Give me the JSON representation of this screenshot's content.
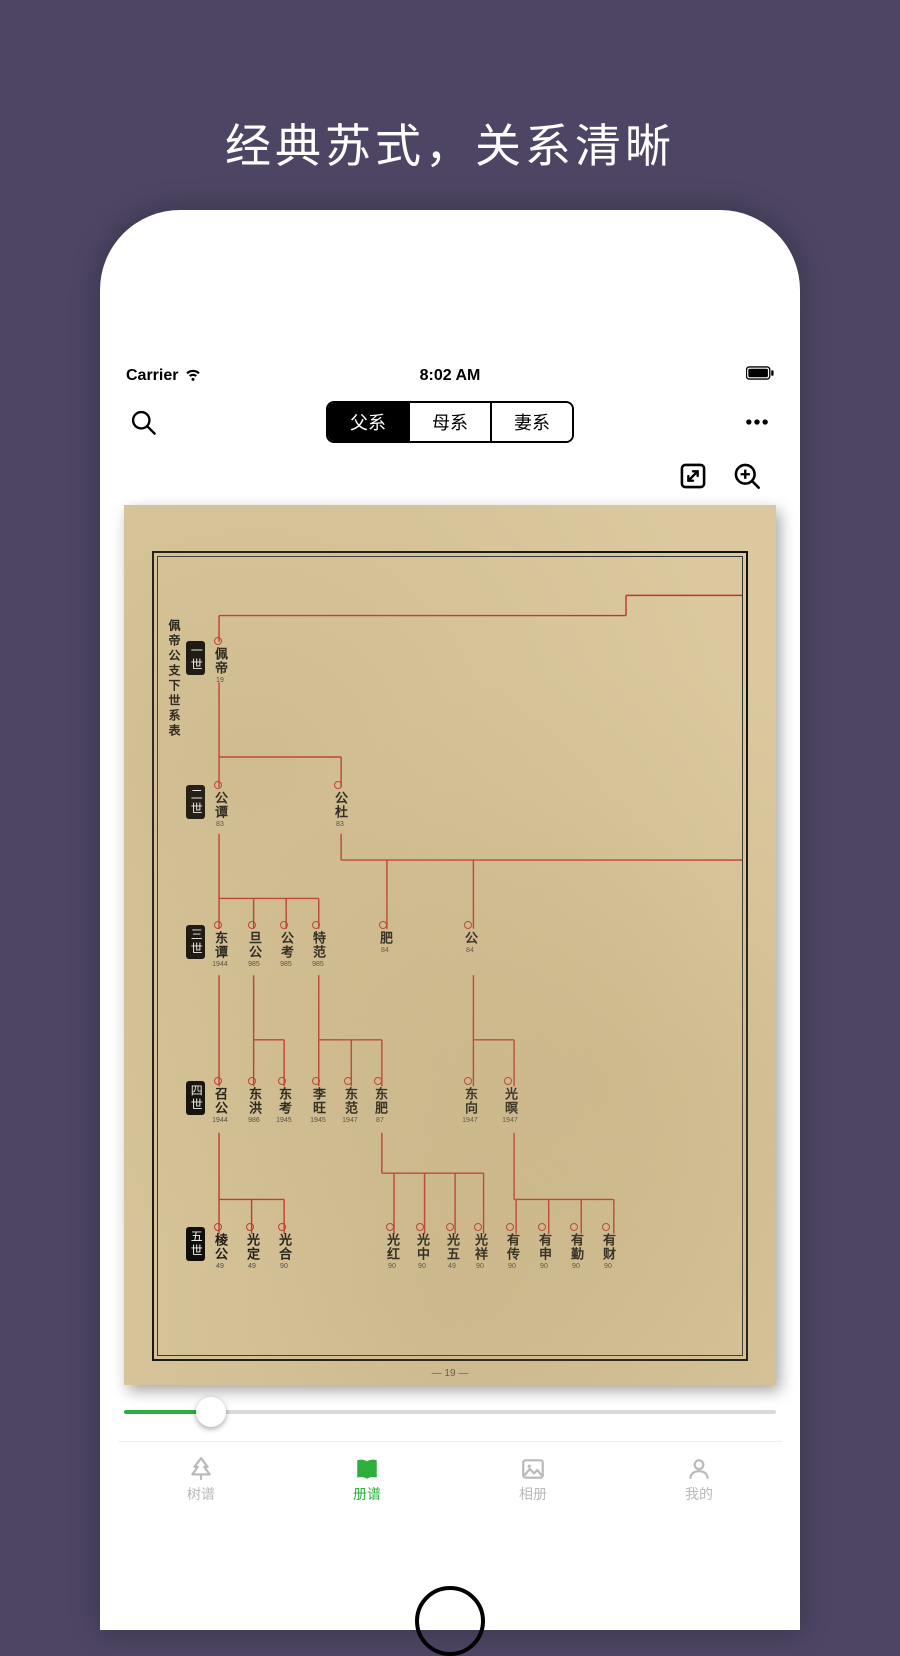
{
  "hero": "经典苏式，关系清晰",
  "status": {
    "carrier": "Carrier",
    "time": "8:02 AM"
  },
  "seg": {
    "active": "父系",
    "opts": [
      "父系",
      "母系",
      "妻系"
    ]
  },
  "pageNum": "— 19 —",
  "chartTitle": "佩帝公支下世系表",
  "gens": [
    "一世",
    "二世",
    "三世",
    "四世",
    "五世"
  ],
  "g1": [
    {
      "n": "佩帝",
      "s": "19"
    }
  ],
  "g2": [
    {
      "n": "公谭",
      "s": "83"
    },
    {
      "n": "公杜",
      "s": "83"
    }
  ],
  "g3": [
    {
      "n": "东谭",
      "s": "1944"
    },
    {
      "n": "旦公",
      "s": "985"
    },
    {
      "n": "公考",
      "s": "985"
    },
    {
      "n": "特范",
      "s": "985"
    },
    {
      "n": "肥",
      "s": "84"
    },
    {
      "n": "公",
      "s": "84"
    }
  ],
  "g4": [
    {
      "n": "召公",
      "s": "1944"
    },
    {
      "n": "东洪",
      "s": "986"
    },
    {
      "n": "东考",
      "s": "1945"
    },
    {
      "n": "李旺",
      "s": "1945"
    },
    {
      "n": "东范",
      "s": "1947"
    },
    {
      "n": "东肥",
      "s": "87"
    },
    {
      "n": "东向",
      "s": "1947"
    },
    {
      "n": "光暝",
      "s": "1947"
    }
  ],
  "g5": [
    {
      "n": "棱公",
      "s": "49"
    },
    {
      "n": "光定",
      "s": "49"
    },
    {
      "n": "光合",
      "s": "90"
    },
    {
      "n": "光红",
      "s": "90"
    },
    {
      "n": "光中",
      "s": "90"
    },
    {
      "n": "光五",
      "s": "49"
    },
    {
      "n": "光祥",
      "s": "90"
    },
    {
      "n": "有传",
      "s": "90"
    },
    {
      "n": "有申",
      "s": "90"
    },
    {
      "n": "有勤",
      "s": "90"
    },
    {
      "n": "有财",
      "s": "90"
    }
  ],
  "tabs": [
    {
      "id": "tree",
      "label": "树谱"
    },
    {
      "id": "book",
      "label": "册谱"
    },
    {
      "id": "album",
      "label": "相册"
    },
    {
      "id": "me",
      "label": "我的"
    }
  ]
}
